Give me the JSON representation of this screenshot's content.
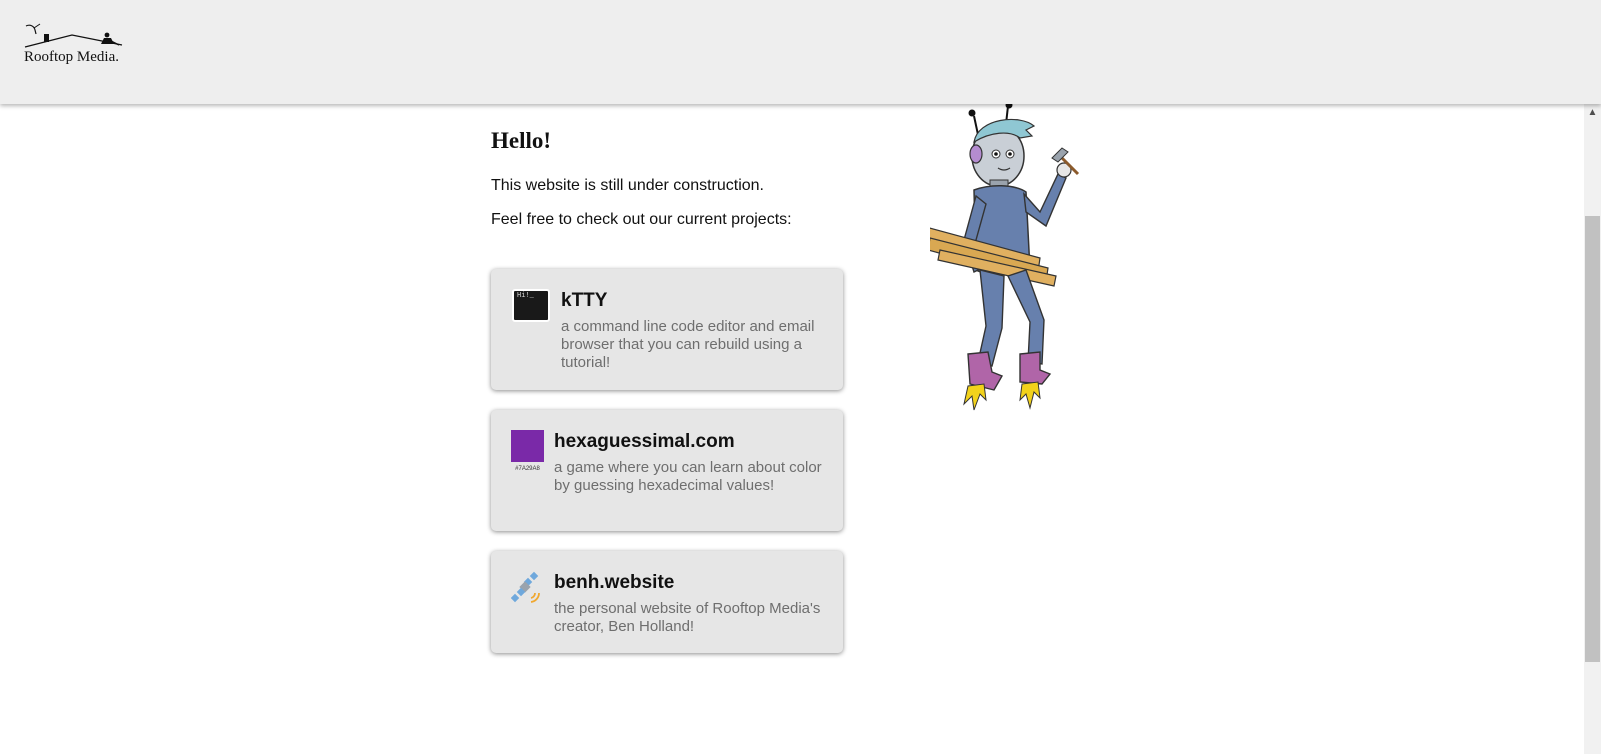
{
  "header": {
    "logo_text": "Rooftop Media."
  },
  "main": {
    "greeting": "Hello!",
    "paragraphs": [
      "This website is still under construction.",
      "Feel free to check out our current projects:"
    ],
    "projects": [
      {
        "title": "kTTY",
        "description": "a command line code editor and email browser that you can rebuild using a tutorial!",
        "icon": "terminal-icon",
        "icon_text": "Hi!_"
      },
      {
        "title": "hexaguessimal.com",
        "description": "a game where you can learn about color by guessing hexadecimal values!",
        "icon": "color-swatch-icon",
        "swatch_code": "#7A29A8",
        "swatch_color": "#7A29A8"
      },
      {
        "title": "benh.website",
        "description": "the personal website of Rooftop Media's creator, Ben Holland!",
        "icon": "satellite-icon"
      }
    ]
  },
  "illustration": {
    "icon": "robot-construction-worker-illustration"
  },
  "colors": {
    "header_bg": "#eeeeee",
    "card_bg": "#e6e6e6",
    "description_text": "#6e6e6e",
    "swatch": "#7A29A8"
  }
}
